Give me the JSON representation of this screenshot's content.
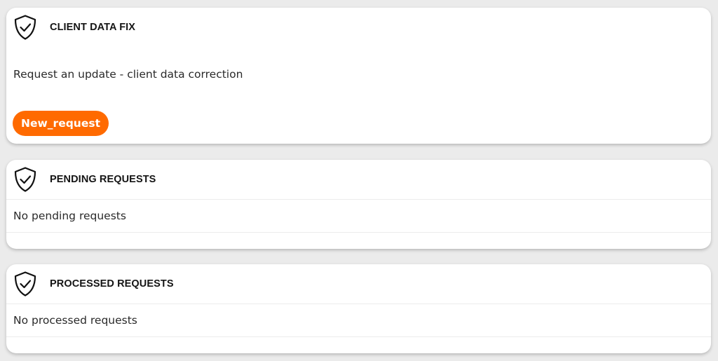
{
  "client_data_fix": {
    "title": "CLIENT DATA FIX",
    "description": "Request an update - client data correction",
    "new_request_label": "New_request",
    "icon": "shield-check-icon"
  },
  "pending_requests": {
    "title": "PENDING REQUESTS",
    "empty_message": "No pending requests",
    "icon": "shield-check-icon"
  },
  "processed_requests": {
    "title": "PROCESSED REQUESTS",
    "empty_message": "No processed requests",
    "icon": "shield-check-icon"
  },
  "colors": {
    "accent": "#ff6a00",
    "background": "#ebebeb",
    "card": "#ffffff"
  }
}
